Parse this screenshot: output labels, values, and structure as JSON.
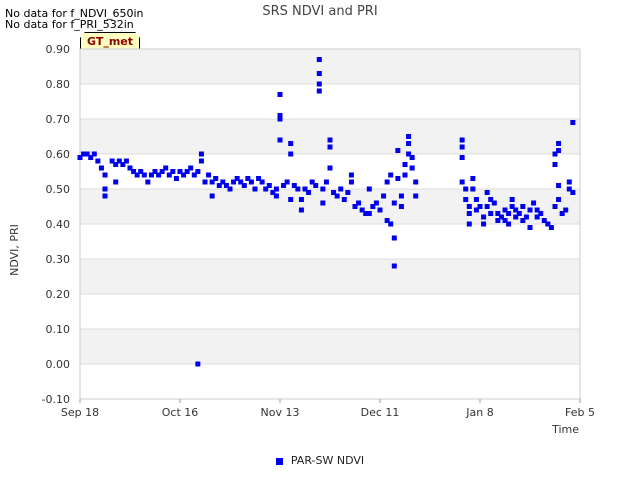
{
  "notes": [
    "No data for f_NDVI_650in",
    "No data for f_PRI_532in"
  ],
  "badge": "GT_met",
  "colors": {
    "series": "#0000ee",
    "band": "#f2f2f2",
    "grid": "#dddddd"
  },
  "chart_data": {
    "type": "scatter",
    "title": "SRS NDVI and PRI",
    "xlabel": "Time",
    "ylabel": "NDVI, PRI",
    "ylim": [
      -0.1,
      0.9
    ],
    "yticks": [
      "-0.10",
      "0.00",
      "0.10",
      "0.20",
      "0.30",
      "0.40",
      "0.50",
      "0.60",
      "0.70",
      "0.80",
      "0.90"
    ],
    "xlim": [
      "2015-09-18",
      "2016-02-05"
    ],
    "xticks": [
      "Sep 18",
      "Oct 16",
      "Nov 13",
      "Dec 11",
      "Jan 8",
      "Feb 5"
    ],
    "legend_position": "bottom",
    "grid": true,
    "series": [
      {
        "name": "PAR-SW NDVI",
        "points": [
          [
            "2015-09-18",
            0.59
          ],
          [
            "2015-09-19",
            0.6
          ],
          [
            "2015-09-20",
            0.6
          ],
          [
            "2015-09-21",
            0.59
          ],
          [
            "2015-09-22",
            0.6
          ],
          [
            "2015-09-23",
            0.58
          ],
          [
            "2015-09-24",
            0.56
          ],
          [
            "2015-09-25",
            0.54
          ],
          [
            "2015-09-25",
            0.5
          ],
          [
            "2015-09-25",
            0.48
          ],
          [
            "2015-09-27",
            0.58
          ],
          [
            "2015-09-28",
            0.57
          ],
          [
            "2015-09-28",
            0.52
          ],
          [
            "2015-09-29",
            0.58
          ],
          [
            "2015-09-30",
            0.57
          ],
          [
            "2015-10-01",
            0.58
          ],
          [
            "2015-10-02",
            0.56
          ],
          [
            "2015-10-03",
            0.55
          ],
          [
            "2015-10-04",
            0.54
          ],
          [
            "2015-10-05",
            0.55
          ],
          [
            "2015-10-06",
            0.54
          ],
          [
            "2015-10-07",
            0.52
          ],
          [
            "2015-10-08",
            0.54
          ],
          [
            "2015-10-09",
            0.55
          ],
          [
            "2015-10-10",
            0.54
          ],
          [
            "2015-10-11",
            0.55
          ],
          [
            "2015-10-12",
            0.56
          ],
          [
            "2015-10-13",
            0.54
          ],
          [
            "2015-10-14",
            0.55
          ],
          [
            "2015-10-15",
            0.53
          ],
          [
            "2015-10-16",
            0.55
          ],
          [
            "2015-10-17",
            0.54
          ],
          [
            "2015-10-18",
            0.55
          ],
          [
            "2015-10-19",
            0.56
          ],
          [
            "2015-10-20",
            0.54
          ],
          [
            "2015-10-21",
            0.55
          ],
          [
            "2015-10-21",
            0.0
          ],
          [
            "2015-10-22",
            0.6
          ],
          [
            "2015-10-22",
            0.58
          ],
          [
            "2015-10-23",
            0.52
          ],
          [
            "2015-10-24",
            0.54
          ],
          [
            "2015-10-25",
            0.52
          ],
          [
            "2015-10-25",
            0.48
          ],
          [
            "2015-10-26",
            0.53
          ],
          [
            "2015-10-27",
            0.51
          ],
          [
            "2015-10-28",
            0.52
          ],
          [
            "2015-10-29",
            0.51
          ],
          [
            "2015-10-30",
            0.5
          ],
          [
            "2015-10-31",
            0.52
          ],
          [
            "2015-11-01",
            0.53
          ],
          [
            "2015-11-02",
            0.52
          ],
          [
            "2015-11-03",
            0.51
          ],
          [
            "2015-11-04",
            0.53
          ],
          [
            "2015-11-05",
            0.52
          ],
          [
            "2015-11-06",
            0.5
          ],
          [
            "2015-11-07",
            0.53
          ],
          [
            "2015-11-08",
            0.52
          ],
          [
            "2015-11-09",
            0.5
          ],
          [
            "2015-11-10",
            0.51
          ],
          [
            "2015-11-11",
            0.49
          ],
          [
            "2015-11-12",
            0.48
          ],
          [
            "2015-11-12",
            0.5
          ],
          [
            "2015-11-13",
            0.77
          ],
          [
            "2015-11-13",
            0.71
          ],
          [
            "2015-11-13",
            0.7
          ],
          [
            "2015-11-13",
            0.64
          ],
          [
            "2015-11-14",
            0.51
          ],
          [
            "2015-11-15",
            0.52
          ],
          [
            "2015-11-16",
            0.63
          ],
          [
            "2015-11-16",
            0.6
          ],
          [
            "2015-11-16",
            0.47
          ],
          [
            "2015-11-17",
            0.51
          ],
          [
            "2015-11-18",
            0.5
          ],
          [
            "2015-11-19",
            0.44
          ],
          [
            "2015-11-19",
            0.47
          ],
          [
            "2015-11-20",
            0.5
          ],
          [
            "2015-11-21",
            0.49
          ],
          [
            "2015-11-22",
            0.52
          ],
          [
            "2015-11-23",
            0.51
          ],
          [
            "2015-11-24",
            0.87
          ],
          [
            "2015-11-24",
            0.83
          ],
          [
            "2015-11-24",
            0.8
          ],
          [
            "2015-11-24",
            0.78
          ],
          [
            "2015-11-25",
            0.5
          ],
          [
            "2015-11-25",
            0.46
          ],
          [
            "2015-11-26",
            0.52
          ],
          [
            "2015-11-27",
            0.56
          ],
          [
            "2015-11-27",
            0.64
          ],
          [
            "2015-11-27",
            0.62
          ],
          [
            "2015-11-28",
            0.49
          ],
          [
            "2015-11-29",
            0.48
          ],
          [
            "2015-11-30",
            0.5
          ],
          [
            "2015-12-01",
            0.47
          ],
          [
            "2015-12-02",
            0.49
          ],
          [
            "2015-12-03",
            0.54
          ],
          [
            "2015-12-03",
            0.52
          ],
          [
            "2015-12-04",
            0.45
          ],
          [
            "2015-12-05",
            0.46
          ],
          [
            "2015-12-06",
            0.44
          ],
          [
            "2015-12-07",
            0.43
          ],
          [
            "2015-12-08",
            0.5
          ],
          [
            "2015-12-08",
            0.43
          ],
          [
            "2015-12-09",
            0.45
          ],
          [
            "2015-12-10",
            0.46
          ],
          [
            "2015-12-11",
            0.44
          ],
          [
            "2015-12-12",
            0.48
          ],
          [
            "2015-12-13",
            0.52
          ],
          [
            "2015-12-13",
            0.41
          ],
          [
            "2015-12-14",
            0.54
          ],
          [
            "2015-12-14",
            0.4
          ],
          [
            "2015-12-15",
            0.36
          ],
          [
            "2015-12-15",
            0.28
          ],
          [
            "2015-12-15",
            0.46
          ],
          [
            "2015-12-16",
            0.61
          ],
          [
            "2015-12-16",
            0.53
          ],
          [
            "2015-12-17",
            0.48
          ],
          [
            "2015-12-17",
            0.45
          ],
          [
            "2015-12-18",
            0.57
          ],
          [
            "2015-12-18",
            0.54
          ],
          [
            "2015-12-19",
            0.65
          ],
          [
            "2015-12-19",
            0.63
          ],
          [
            "2015-12-19",
            0.6
          ],
          [
            "2015-12-20",
            0.59
          ],
          [
            "2015-12-20",
            0.56
          ],
          [
            "2015-12-21",
            0.52
          ],
          [
            "2015-12-21",
            0.48
          ],
          [
            "2016-01-03",
            0.64
          ],
          [
            "2016-01-03",
            0.62
          ],
          [
            "2016-01-03",
            0.59
          ],
          [
            "2016-01-03",
            0.52
          ],
          [
            "2016-01-04",
            0.5
          ],
          [
            "2016-01-04",
            0.47
          ],
          [
            "2016-01-05",
            0.45
          ],
          [
            "2016-01-05",
            0.4
          ],
          [
            "2016-01-05",
            0.43
          ],
          [
            "2016-01-06",
            0.53
          ],
          [
            "2016-01-06",
            0.5
          ],
          [
            "2016-01-07",
            0.47
          ],
          [
            "2016-01-07",
            0.44
          ],
          [
            "2016-01-08",
            0.45
          ],
          [
            "2016-01-09",
            0.42
          ],
          [
            "2016-01-09",
            0.4
          ],
          [
            "2016-01-10",
            0.49
          ],
          [
            "2016-01-10",
            0.45
          ],
          [
            "2016-01-11",
            0.47
          ],
          [
            "2016-01-11",
            0.43
          ],
          [
            "2016-01-12",
            0.46
          ],
          [
            "2016-01-13",
            0.43
          ],
          [
            "2016-01-13",
            0.41
          ],
          [
            "2016-01-14",
            0.42
          ],
          [
            "2016-01-15",
            0.44
          ],
          [
            "2016-01-15",
            0.41
          ],
          [
            "2016-01-16",
            0.43
          ],
          [
            "2016-01-16",
            0.4
          ],
          [
            "2016-01-17",
            0.47
          ],
          [
            "2016-01-17",
            0.45
          ],
          [
            "2016-01-18",
            0.44
          ],
          [
            "2016-01-18",
            0.42
          ],
          [
            "2016-01-19",
            0.43
          ],
          [
            "2016-01-20",
            0.45
          ],
          [
            "2016-01-20",
            0.41
          ],
          [
            "2016-01-21",
            0.42
          ],
          [
            "2016-01-22",
            0.39
          ],
          [
            "2016-01-22",
            0.44
          ],
          [
            "2016-01-23",
            0.46
          ],
          [
            "2016-01-24",
            0.44
          ],
          [
            "2016-01-24",
            0.42
          ],
          [
            "2016-01-25",
            0.43
          ],
          [
            "2016-01-26",
            0.41
          ],
          [
            "2016-01-27",
            0.4
          ],
          [
            "2016-01-28",
            0.39
          ],
          [
            "2016-01-29",
            0.45
          ],
          [
            "2016-01-29",
            0.6
          ],
          [
            "2016-01-29",
            0.57
          ],
          [
            "2016-01-30",
            0.63
          ],
          [
            "2016-01-30",
            0.61
          ],
          [
            "2016-01-30",
            0.47
          ],
          [
            "2016-01-30",
            0.51
          ],
          [
            "2016-01-31",
            0.43
          ],
          [
            "2016-02-01",
            0.44
          ],
          [
            "2016-02-02",
            0.52
          ],
          [
            "2016-02-02",
            0.5
          ],
          [
            "2016-02-03",
            0.69
          ],
          [
            "2016-02-03",
            0.49
          ]
        ]
      }
    ]
  }
}
